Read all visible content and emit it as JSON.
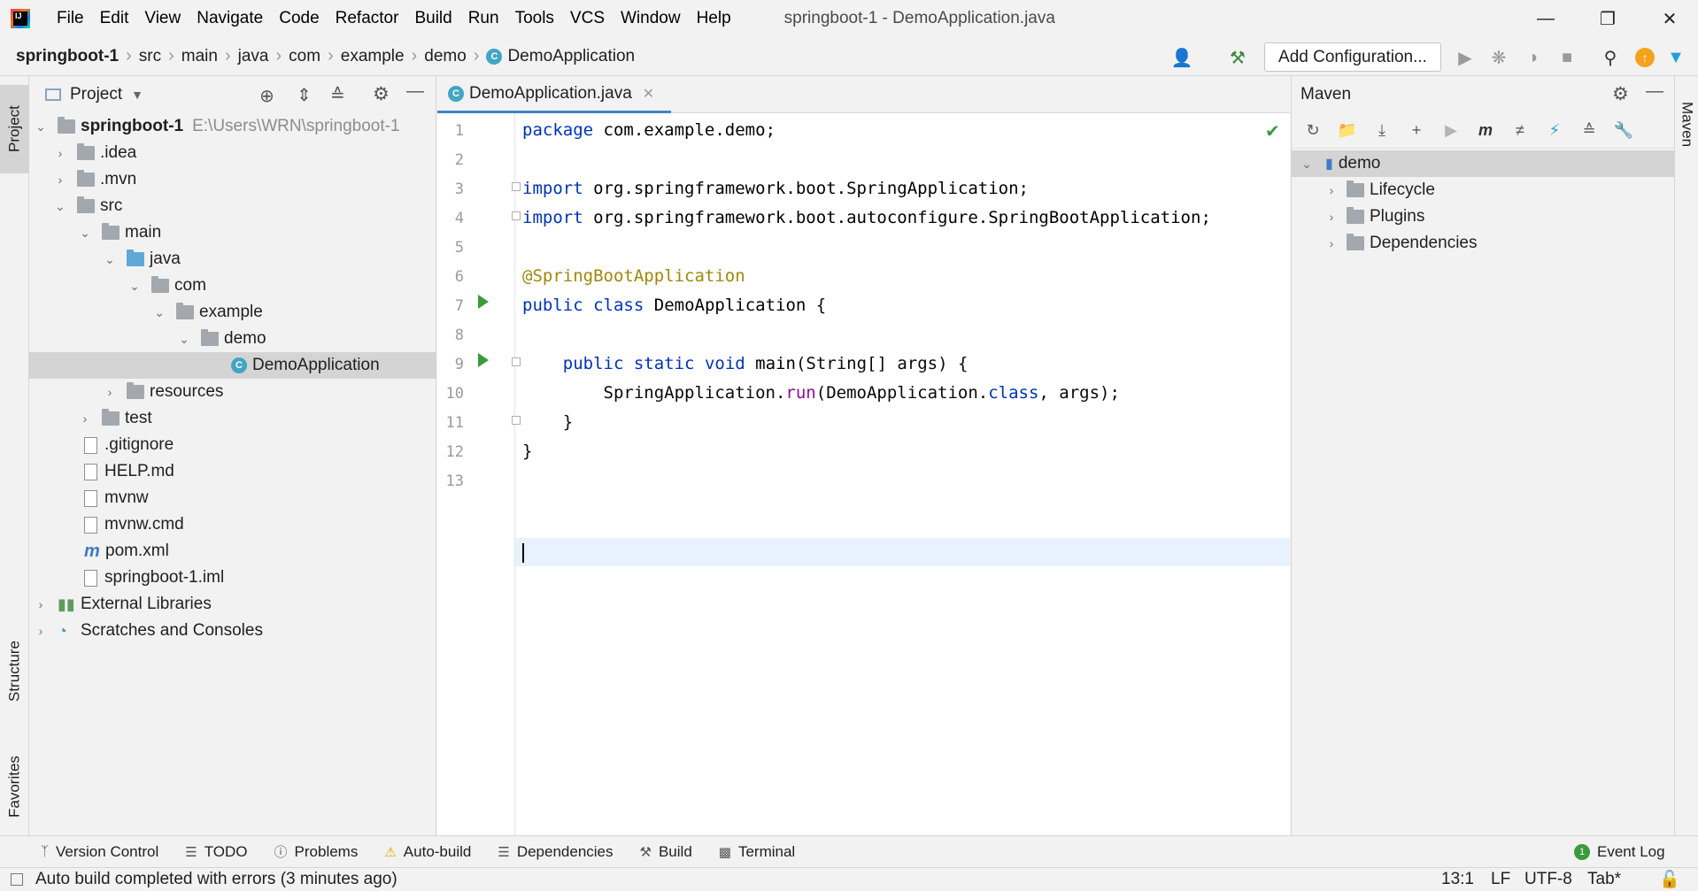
{
  "menu": {
    "items": [
      "File",
      "Edit",
      "View",
      "Navigate",
      "Code",
      "Refactor",
      "Build",
      "Run",
      "Tools",
      "VCS",
      "Window",
      "Help"
    ],
    "window_title": "springboot-1 - DemoApplication.java"
  },
  "breadcrumb": {
    "items": [
      "springboot-1",
      "src",
      "main",
      "java",
      "com",
      "example",
      "demo"
    ],
    "current": "DemoApplication"
  },
  "toolbar": {
    "add_configuration": "Add Configuration..."
  },
  "left_strip": {
    "project_tab": "Project",
    "structure_tab": "Structure",
    "favorites_tab": "Favorites"
  },
  "right_strip": {
    "maven_tab": "Maven"
  },
  "project": {
    "title": "Project",
    "root_name": "springboot-1",
    "root_path": "E:\\Users\\WRN\\springboot-1",
    "nodes": [
      {
        "label": ".idea"
      },
      {
        "label": ".mvn"
      },
      {
        "label": "src"
      },
      {
        "label": "main"
      },
      {
        "label": "java"
      },
      {
        "label": "com"
      },
      {
        "label": "example"
      },
      {
        "label": "demo"
      },
      {
        "label": "DemoApplication"
      },
      {
        "label": "resources"
      },
      {
        "label": "test"
      },
      {
        "label": ".gitignore"
      },
      {
        "label": "HELP.md"
      },
      {
        "label": "mvnw"
      },
      {
        "label": "mvnw.cmd"
      },
      {
        "label": "pom.xml"
      },
      {
        "label": "springboot-1.iml"
      },
      {
        "label": "External Libraries"
      },
      {
        "label": "Scratches and Consoles"
      }
    ]
  },
  "editor": {
    "tab_label": "DemoApplication.java",
    "line_numbers": [
      "1",
      "2",
      "3",
      "4",
      "5",
      "6",
      "7",
      "8",
      "9",
      "10",
      "11",
      "12",
      "13"
    ]
  },
  "maven": {
    "title": "Maven",
    "root": "demo",
    "children": [
      "Lifecycle",
      "Plugins",
      "Dependencies"
    ]
  },
  "bottom_tabs": {
    "version_control": "Version Control",
    "todo": "TODO",
    "problems": "Problems",
    "auto_build": "Auto-build",
    "dependencies": "Dependencies",
    "build": "Build",
    "terminal": "Terminal",
    "event_log": "Event Log"
  },
  "status": {
    "message": "Auto build completed with errors (3 minutes ago)",
    "position": "13:1",
    "line_ending": "LF",
    "encoding": "UTF-8",
    "indent": "Tab*"
  },
  "colors": {
    "accent": "#4083c9",
    "run_green": "#3a9b3a",
    "keyword": "#0033b3",
    "annotation": "#9e880d"
  }
}
